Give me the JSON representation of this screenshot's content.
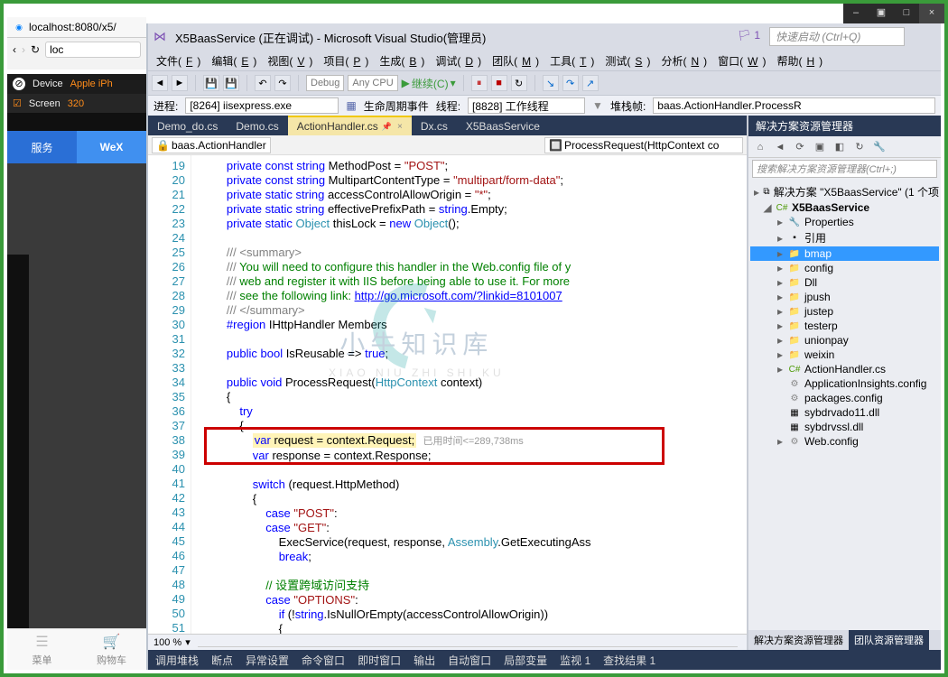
{
  "browser": {
    "tab": "localhost:8080/x5/",
    "url": "loc",
    "back_icon": "‹",
    "fwd_icon": "›",
    "reload_icon": "↻"
  },
  "left": {
    "device_label": "Device",
    "device_model": "Apple iPh",
    "screen_label": "Screen",
    "screen_val": "320",
    "blue_left": "服务",
    "blue_right": "WeX",
    "menu": "菜单",
    "cart": "购物车"
  },
  "sys": {
    "min": "–",
    "max": "□",
    "restore": "▣",
    "close": "×"
  },
  "vs": {
    "title": "X5BaasService (正在调试) - Microsoft Visual Studio(管理员)",
    "quick": "快速启动 (Ctrl+Q)",
    "flag_count": "1",
    "menu": [
      "文件(F)",
      "编辑(E)",
      "视图(V)",
      "项目(P)",
      "生成(B)",
      "调试(D)",
      "团队(M)",
      "工具(T)",
      "测试(S)",
      "分析(N)",
      "窗口(W)",
      "帮助(H)"
    ],
    "tb": {
      "debug": "Debug",
      "cpu": "Any CPU",
      "continue": "继续(C)"
    },
    "proc": {
      "label": "进程:",
      "val": "[8264] iisexpress.exe",
      "life": "生命周期事件",
      "thread": "线程:",
      "thread_val": "[8828] 工作线程",
      "stack": "堆栈帧:",
      "stack_val": "baas.ActionHandler.ProcessR"
    },
    "tabs": [
      {
        "label": "Demo_do.cs"
      },
      {
        "label": "Demo.cs"
      },
      {
        "label": "ActionHandler.cs",
        "active": true,
        "pin": true
      },
      {
        "label": "Dx.cs"
      },
      {
        "label": "X5BaasService"
      }
    ],
    "crumb_left": "baas.ActionHandler",
    "crumb_right": "ProcessRequest(HttpContext co",
    "lines_start": 19,
    "lines_end": 51,
    "zoom": "100 %",
    "foot": [
      "调用堆栈",
      "断点",
      "异常设置",
      "命令窗口",
      "即时窗口",
      "输出",
      "自动窗口",
      "局部变量",
      "监视 1",
      "查找结果 1"
    ],
    "hint": "已用时间<=289,738ms"
  },
  "sol": {
    "title": "解决方案资源管理器",
    "search": "搜索解决方案资源管理器(Ctrl+;)",
    "root": "解决方案 \"X5BaasService\" (1 个项",
    "project": "X5BaasService",
    "items": [
      "Properties",
      "引用",
      "bmap",
      "config",
      "Dll",
      "jpush",
      "justep",
      "testerp",
      "unionpay",
      "weixin",
      "ActionHandler.cs",
      "ApplicationInsights.config",
      "packages.config",
      "sybdrvado11.dll",
      "sybdrvssl.dll",
      "Web.config"
    ],
    "sel": "bmap",
    "foot": [
      "解决方案资源管理器",
      "团队资源管理器"
    ]
  },
  "wm": {
    "t1": "小牛知识库",
    "t2": "XIAO NIU ZHI SHI KU"
  }
}
